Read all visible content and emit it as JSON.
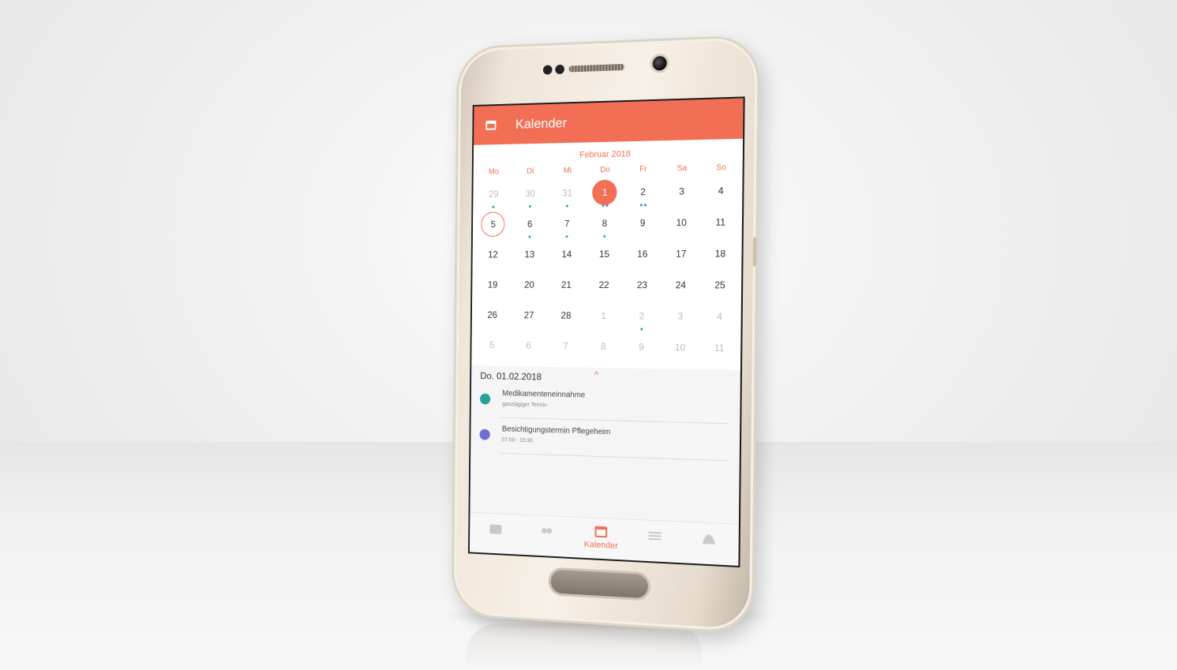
{
  "app": {
    "title": "Kalender",
    "accent": "#f26f55",
    "app_icon": "calendar-icon"
  },
  "calendar": {
    "month_label": "Februar 2018",
    "weekdays": [
      "Mo",
      "Di",
      "Mi",
      "Do",
      "Fr",
      "Sa",
      "So"
    ],
    "selected_day": "1",
    "today_day": "5",
    "weeks": [
      [
        {
          "d": "29",
          "muted": true,
          "dots": [
            "#2aa198"
          ]
        },
        {
          "d": "30",
          "muted": true,
          "dots": [
            "#2aa198"
          ]
        },
        {
          "d": "31",
          "muted": true,
          "dots": [
            "#2aa198"
          ]
        },
        {
          "d": "1",
          "selected": true,
          "dots": [
            "#2aa198",
            "#6a6fd0"
          ]
        },
        {
          "d": "2",
          "dots": [
            "#2aa198",
            "#6a6fd0"
          ]
        },
        {
          "d": "3"
        },
        {
          "d": "4"
        }
      ],
      [
        {
          "d": "5",
          "today": true
        },
        {
          "d": "6",
          "dots": [
            "#2aa198"
          ]
        },
        {
          "d": "7",
          "dots": [
            "#2aa198"
          ]
        },
        {
          "d": "8",
          "dots": [
            "#2aa198"
          ]
        },
        {
          "d": "9"
        },
        {
          "d": "10"
        },
        {
          "d": "11"
        }
      ],
      [
        {
          "d": "12"
        },
        {
          "d": "13"
        },
        {
          "d": "14"
        },
        {
          "d": "15"
        },
        {
          "d": "16"
        },
        {
          "d": "17"
        },
        {
          "d": "18"
        }
      ],
      [
        {
          "d": "19"
        },
        {
          "d": "20"
        },
        {
          "d": "21"
        },
        {
          "d": "22"
        },
        {
          "d": "23"
        },
        {
          "d": "24"
        },
        {
          "d": "25"
        }
      ],
      [
        {
          "d": "26"
        },
        {
          "d": "27"
        },
        {
          "d": "28"
        },
        {
          "d": "1",
          "muted": true
        },
        {
          "d": "2",
          "muted": true,
          "dots": [
            "#2aa198"
          ]
        },
        {
          "d": "3",
          "muted": true
        },
        {
          "d": "4",
          "muted": true
        }
      ],
      [
        {
          "d": "5",
          "muted": true
        },
        {
          "d": "6",
          "muted": true
        },
        {
          "d": "7",
          "muted": true
        },
        {
          "d": "8",
          "muted": true
        },
        {
          "d": "9",
          "muted": true
        },
        {
          "d": "10",
          "muted": true
        },
        {
          "d": "11",
          "muted": true
        }
      ]
    ]
  },
  "agenda": {
    "date_label": "Do. 01.02.2018",
    "collapse_icon": "chevron-up-icon",
    "events": [
      {
        "title": "Medikamenteneinnahme",
        "subtitle": "ganztägiger Termin",
        "color": "#2aa198"
      },
      {
        "title": "Besichtigungstermin Pflegeheim",
        "subtitle": "07:00 - 15:30",
        "color": "#6a6fd0"
      }
    ]
  },
  "bottom_nav": {
    "items": [
      {
        "icon": "chat-icon"
      },
      {
        "icon": "group-icon"
      },
      {
        "icon": "calendar-icon",
        "label": "Kalender",
        "active": true
      },
      {
        "icon": "list-icon"
      },
      {
        "icon": "person-icon"
      }
    ]
  }
}
